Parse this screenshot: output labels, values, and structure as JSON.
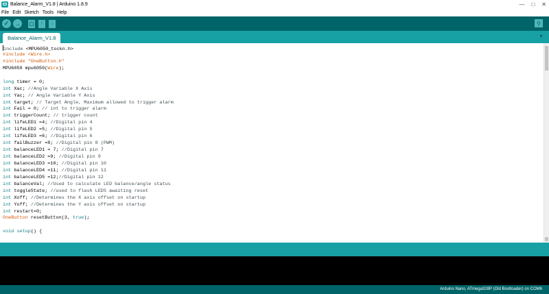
{
  "window": {
    "title": "Balance_Alarm_V1.8 | Arduino 1.8.9",
    "controls": [
      "—",
      "□",
      "✕"
    ]
  },
  "menu": [
    "File",
    "Edit",
    "Sketch",
    "Tools",
    "Help"
  ],
  "toolbar": {
    "verify": "✓",
    "upload": "→",
    "new": "▢",
    "open": "↑",
    "save": "↓",
    "monitor": "⚲"
  },
  "tab": {
    "label": "Balance_Alarm_V1.8",
    "menu_icon": "▼"
  },
  "code_lines": [
    [
      [
        "c",
        "#include "
      ],
      [
        "p",
        "<MPU6050_tockn.h>"
      ]
    ],
    [
      [
        "o",
        "#include "
      ],
      [
        "o",
        "<Wire.h>"
      ]
    ],
    [
      [
        "o",
        "#include "
      ],
      [
        "o",
        "\"OneButton.h\""
      ]
    ],
    [
      [
        "p",
        "MPU6050 mpu6050("
      ],
      [
        "o",
        "Wire"
      ],
      [
        "p",
        ");"
      ]
    ],
    [
      [
        "p",
        ""
      ]
    ],
    [
      [
        "k",
        "long"
      ],
      [
        "p",
        " timer = 0;"
      ]
    ],
    [
      [
        "k",
        "int"
      ],
      [
        "p",
        " Xac; "
      ],
      [
        "c",
        "//Angle Variable X Axis"
      ]
    ],
    [
      [
        "k",
        "int"
      ],
      [
        "p",
        " Yac; "
      ],
      [
        "c",
        "// Angle Variable Y Axis"
      ]
    ],
    [
      [
        "k",
        "int"
      ],
      [
        "p",
        " target; "
      ],
      [
        "c",
        "// Target Angle, Maximum allowed to trigger alarm"
      ]
    ],
    [
      [
        "k",
        "int"
      ],
      [
        "p",
        " Fail = 0; "
      ],
      [
        "c",
        "// int to trigger alarm"
      ]
    ],
    [
      [
        "k",
        "int"
      ],
      [
        "p",
        " triggerCount; "
      ],
      [
        "c",
        "// trigger count"
      ]
    ],
    [
      [
        "k",
        "int"
      ],
      [
        "p",
        " lifeLED1 =4; "
      ],
      [
        "c",
        "//Digital pin 4"
      ]
    ],
    [
      [
        "k",
        "int"
      ],
      [
        "p",
        " lifeLED2 =5; "
      ],
      [
        "c",
        "//Digital pin 5"
      ]
    ],
    [
      [
        "k",
        "int"
      ],
      [
        "p",
        " lifeLED3 =6; "
      ],
      [
        "c",
        "//Digital pin 6"
      ]
    ],
    [
      [
        "k",
        "int"
      ],
      [
        "p",
        " failBuzzer =8; "
      ],
      [
        "c",
        "//Digital pin 8 (PWM)"
      ]
    ],
    [
      [
        "k",
        "int"
      ],
      [
        "p",
        " balanceLED1 = 7; "
      ],
      [
        "c",
        "//Digital pin 7"
      ]
    ],
    [
      [
        "k",
        "int"
      ],
      [
        "p",
        " balanceLED2 =9; "
      ],
      [
        "c",
        "//Digital pin 9"
      ]
    ],
    [
      [
        "k",
        "int"
      ],
      [
        "p",
        " balanceLED3 =10; "
      ],
      [
        "c",
        "//Digital pin 10"
      ]
    ],
    [
      [
        "k",
        "int"
      ],
      [
        "p",
        " balanceLED4 =11; "
      ],
      [
        "c",
        "//Digital pin 11"
      ]
    ],
    [
      [
        "k",
        "int"
      ],
      [
        "p",
        " balanceLED5 =12;"
      ],
      [
        "c",
        "//Digital pin 12"
      ]
    ],
    [
      [
        "k",
        "int"
      ],
      [
        "p",
        " balanceVal; "
      ],
      [
        "c",
        "//Used to calculate LED balance/angle status"
      ]
    ],
    [
      [
        "k",
        "int"
      ],
      [
        "p",
        " toggleState; "
      ],
      [
        "c",
        "//used to flash LEDS awaiting reset"
      ]
    ],
    [
      [
        "k",
        "int"
      ],
      [
        "p",
        " Xoff; "
      ],
      [
        "c",
        "//Determines the X axis offset on startup"
      ]
    ],
    [
      [
        "k",
        "int"
      ],
      [
        "p",
        " Yoff; "
      ],
      [
        "c",
        "//Determines the Y axis offset on startup"
      ]
    ],
    [
      [
        "k",
        "int"
      ],
      [
        "p",
        " restart=0;"
      ]
    ],
    [
      [
        "o",
        "OneButton"
      ],
      [
        "p",
        " resetButton(3, "
      ],
      [
        "k",
        "true"
      ],
      [
        "p",
        ");"
      ]
    ],
    [
      [
        "p",
        ""
      ]
    ],
    [
      [
        "k",
        "void"
      ],
      [
        "p",
        " "
      ],
      [
        "k",
        "setup"
      ],
      [
        "p",
        "() {"
      ]
    ]
  ],
  "footer": {
    "board": "Arduino Nano, ATmega328P (Old Bootloader) on COM6"
  },
  "colors": {
    "dark_teal": "#006468",
    "teal": "#17a1a5",
    "keyword": "#0e7f86",
    "type": "#d35400"
  }
}
